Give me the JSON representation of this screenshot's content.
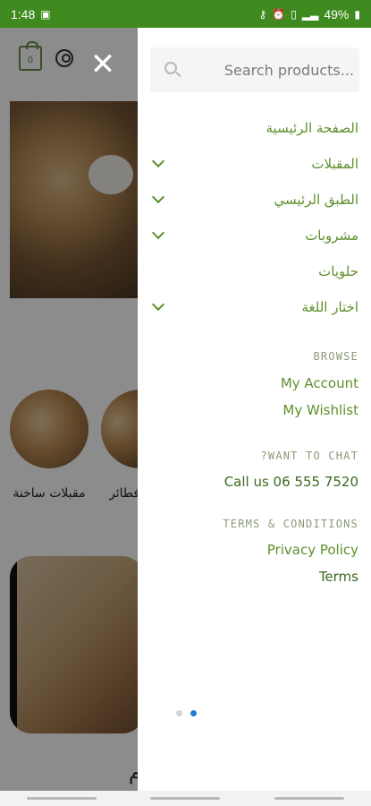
{
  "status_bar": {
    "time": "1:48",
    "battery": "49%",
    "icons": [
      "image-icon",
      "key-icon",
      "alarm-icon",
      "vibrate-icon",
      "signal-icon",
      "battery-icon"
    ]
  },
  "background": {
    "cart_count": "0",
    "category_1": "مقبلات ساخنة",
    "category_2": "فطائر",
    "bottom_title": "م"
  },
  "drawer": {
    "search": {
      "placeholder": "Search products..."
    },
    "menu": [
      {
        "label": "الصفحة الرئيسية",
        "has_children": false
      },
      {
        "label": "المقبلات",
        "has_children": true
      },
      {
        "label": "الطبق الرئيسي",
        "has_children": true
      },
      {
        "label": "مشروبات",
        "has_children": true
      },
      {
        "label": "حلويات",
        "has_children": false
      },
      {
        "label": "اختار اللغة",
        "has_children": true
      }
    ],
    "browse": {
      "heading": "BROWSE",
      "my_account": "My Account",
      "my_wishlist": "My Wishlist"
    },
    "chat": {
      "heading": "?WANT TO CHAT",
      "call": "Call us 06 555 7520"
    },
    "terms": {
      "heading": "TERMS & CONDITIONS",
      "privacy": "Privacy Policy",
      "terms": "Terms"
    },
    "pager": {
      "count": 2,
      "active": 2
    }
  },
  "colors": {
    "status_bar": "#3f8a1e",
    "menu_text": "#5f8f2c",
    "heading_text": "#8d9a79",
    "active_dot": "#1f7bd8"
  }
}
